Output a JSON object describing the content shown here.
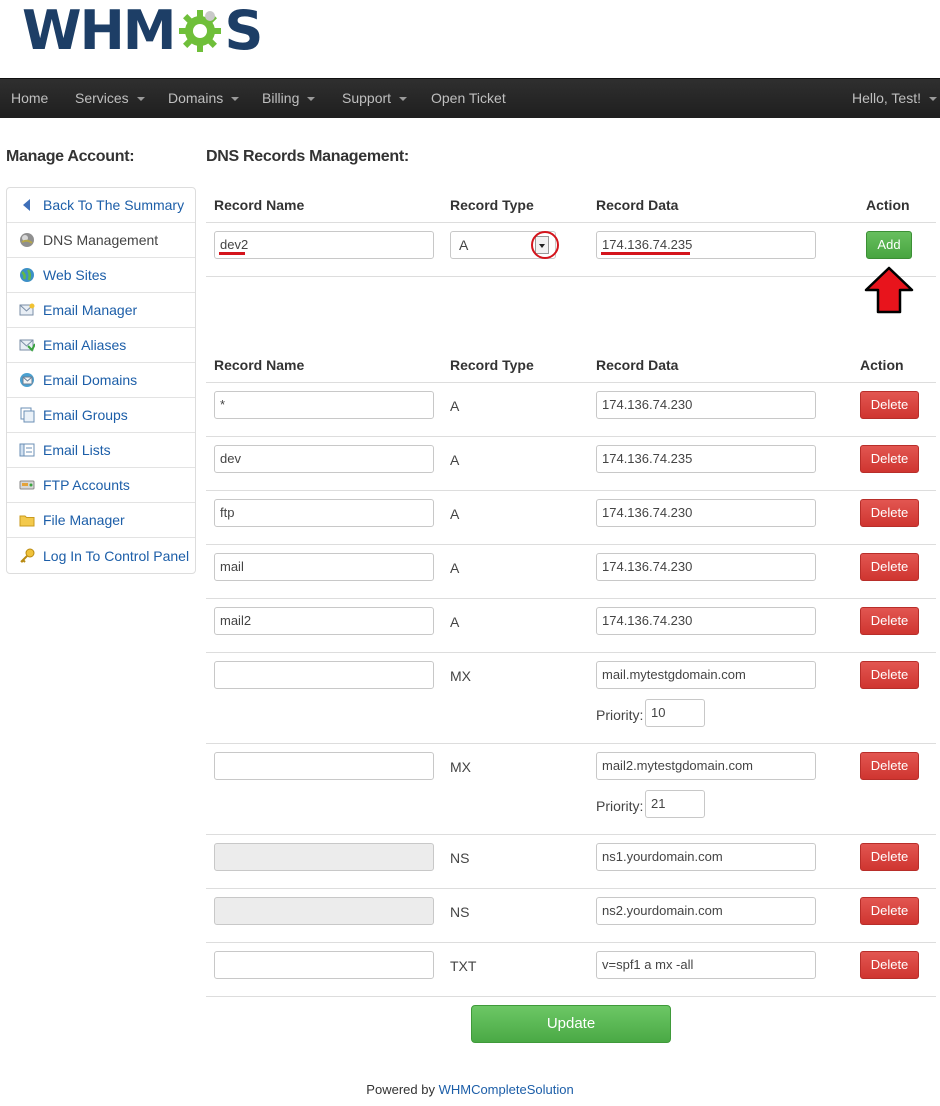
{
  "brand": {
    "logo_left": "WHM",
    "logo_right": "S"
  },
  "nav": {
    "items": [
      {
        "label": "Home",
        "dropdown": false
      },
      {
        "label": "Services",
        "dropdown": true
      },
      {
        "label": "Domains",
        "dropdown": true
      },
      {
        "label": "Billing",
        "dropdown": true
      },
      {
        "label": "Support",
        "dropdown": true
      },
      {
        "label": "Open Ticket",
        "dropdown": false
      }
    ],
    "user": "Hello, Test!"
  },
  "sidebar": {
    "title": "Manage Account:",
    "items": [
      {
        "label": "Back To The Summary",
        "icon": "triangle-left-icon"
      },
      {
        "label": "DNS Management",
        "icon": "globe-icon"
      },
      {
        "label": "Web Sites",
        "icon": "globe-icon"
      },
      {
        "label": "Email Manager",
        "icon": "envelope-icon"
      },
      {
        "label": "Email Aliases",
        "icon": "envelope-icon"
      },
      {
        "label": "Email Domains",
        "icon": "email-domain-icon"
      },
      {
        "label": "Email Groups",
        "icon": "pages-icon"
      },
      {
        "label": "Email Lists",
        "icon": "list-icon"
      },
      {
        "label": "FTP Accounts",
        "icon": "ftp-icon"
      },
      {
        "label": "File Manager",
        "icon": "folder-icon"
      },
      {
        "label": "Log In To Control Panel",
        "icon": "key-icon"
      }
    ]
  },
  "main": {
    "title": "DNS Records Management:",
    "headers": {
      "name": "Record Name",
      "type": "Record Type",
      "data": "Record Data",
      "action": "Action"
    },
    "new_record": {
      "name": "dev2",
      "type": "A",
      "data": "174.136.74.235",
      "button": "Add"
    },
    "records": [
      {
        "name": "*",
        "type": "A",
        "data": "174.136.74.230",
        "priority": null,
        "disabled": false
      },
      {
        "name": "dev",
        "type": "A",
        "data": "174.136.74.235",
        "priority": null,
        "disabled": false
      },
      {
        "name": "ftp",
        "type": "A",
        "data": "174.136.74.230",
        "priority": null,
        "disabled": false
      },
      {
        "name": "mail",
        "type": "A",
        "data": "174.136.74.230",
        "priority": null,
        "disabled": false
      },
      {
        "name": "mail2",
        "type": "A",
        "data": "174.136.74.230",
        "priority": null,
        "disabled": false
      },
      {
        "name": "",
        "type": "MX",
        "data": "mail.mytestgdomain.com",
        "priority": "10",
        "disabled": false
      },
      {
        "name": "",
        "type": "MX",
        "data": "mail2.mytestgdomain.com",
        "priority": "21",
        "disabled": false
      },
      {
        "name": "",
        "type": "NS",
        "data": "ns1.yourdomain.com",
        "priority": null,
        "disabled": true
      },
      {
        "name": "",
        "type": "NS",
        "data": "ns2.yourdomain.com",
        "priority": null,
        "disabled": true
      },
      {
        "name": "",
        "type": "TXT",
        "data": "v=spf1 a mx -all",
        "priority": null,
        "disabled": false
      }
    ],
    "delete_label": "Delete",
    "priority_label": "Priority:",
    "update_label": "Update"
  },
  "footer": {
    "prefix": "Powered by",
    "link": "WHMCompleteSolution"
  },
  "colors": {
    "nav_bg": "#262626",
    "link": "#1c5ea8",
    "delete": "#d9433e",
    "add": "#56b04d",
    "annotation": "#d4141c"
  }
}
